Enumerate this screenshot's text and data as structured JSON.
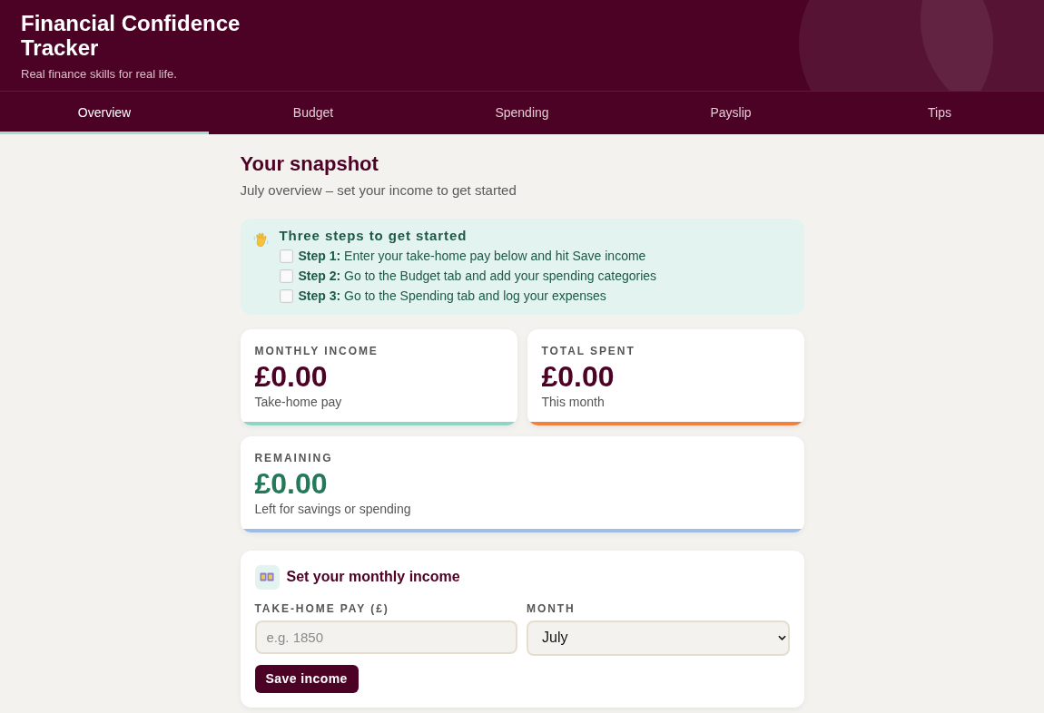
{
  "header": {
    "title": "Financial Confidence Tracker",
    "tagline": "Real finance skills for real life."
  },
  "tabs": [
    {
      "label": "Overview",
      "selected": true
    },
    {
      "label": "Budget",
      "selected": false
    },
    {
      "label": "Spending",
      "selected": false
    },
    {
      "label": "Payslip",
      "selected": false
    },
    {
      "label": "Tips",
      "selected": false
    }
  ],
  "snapshot": {
    "title": "Your snapshot",
    "subtitle": "July overview – set your income to get started"
  },
  "getting_started": {
    "title": "Three steps to get started",
    "steps": [
      {
        "text": "**Step 1:** Enter your take-home pay below and hit Save income",
        "done": false
      },
      {
        "text": "**Step 2:** Go to the Budget tab and add your spending categories",
        "done": false
      },
      {
        "text": "**Step 3:** Go to the Spending tab and log your expenses",
        "done": false
      }
    ]
  },
  "stats": [
    {
      "kind": "amount",
      "label": "MONTHLY INCOME",
      "value": "£0.00",
      "caption": "Take-home pay",
      "color": "#8fd5c5"
    },
    {
      "kind": "amount",
      "label": "TOTAL SPENT",
      "value": "£0.00",
      "caption": "This month",
      "color": "#f57f3e"
    },
    {
      "kind": "balance",
      "label": "REMAINING",
      "value": "£0.00",
      "caption": "Left for savings or spending",
      "color": "#9dbde8"
    }
  ],
  "income_form": {
    "title": "Set your monthly income",
    "pay_field": {
      "label": "TAKE-HOME PAY (£)",
      "placeholder": "e.g. 1850"
    },
    "month_field": {
      "label": "MONTH",
      "value": "July"
    },
    "save_button": "Save income"
  }
}
